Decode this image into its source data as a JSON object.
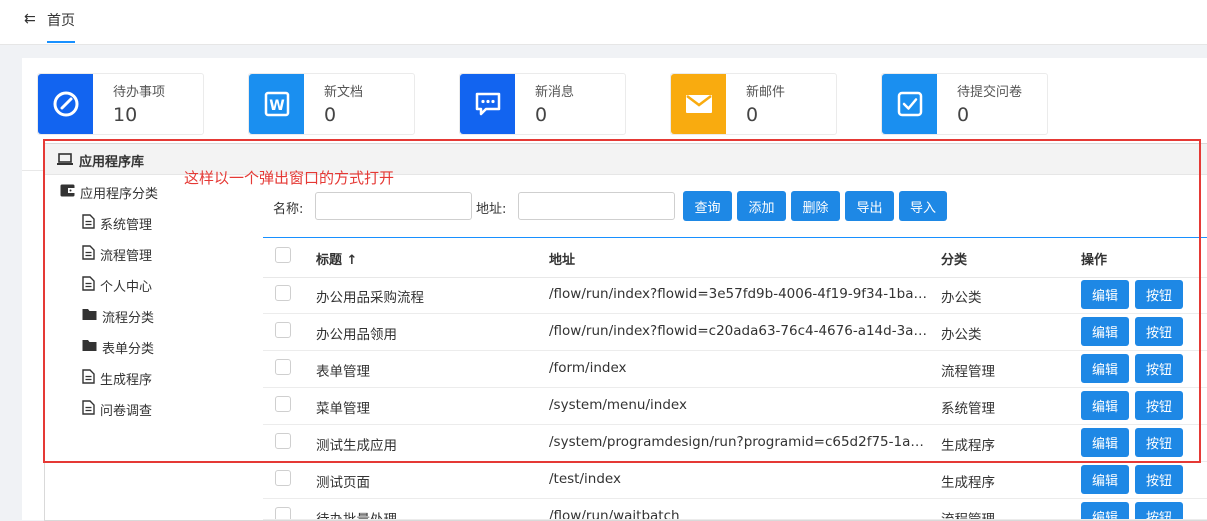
{
  "topbar": {
    "back_icon": "back-arrow-icon",
    "tab_label": "首页",
    "accent": "#1890ff"
  },
  "cards": [
    {
      "title": "待办事项",
      "value": "10",
      "icon": "edit-icon",
      "color": "#1677ff"
    },
    {
      "title": "新文档",
      "value": "0",
      "icon": "word-icon",
      "color": "#1890ff"
    },
    {
      "title": "新消息",
      "value": "0",
      "icon": "message-icon",
      "color": "#1677ff"
    },
    {
      "title": "新邮件",
      "value": "0",
      "icon": "mail-icon",
      "color": "#faad14"
    },
    {
      "title": "待提交问卷",
      "value": "0",
      "icon": "checkbox-icon",
      "color": "#1890ff"
    }
  ],
  "popup": {
    "title": "应用程序库",
    "tree": {
      "root": "应用程序分类",
      "items": [
        {
          "label": "系统管理",
          "icon": "file-icon"
        },
        {
          "label": "流程管理",
          "icon": "file-icon"
        },
        {
          "label": "个人中心",
          "icon": "file-icon"
        },
        {
          "label": "流程分类",
          "icon": "folder-icon"
        },
        {
          "label": "表单分类",
          "icon": "folder-icon"
        },
        {
          "label": "生成程序",
          "icon": "file-icon"
        },
        {
          "label": "问卷调查",
          "icon": "file-icon"
        }
      ]
    },
    "search": {
      "name_label": "名称:",
      "name_value": "",
      "address_label": "地址:",
      "address_value": ""
    },
    "buttons": [
      "查询",
      "添加",
      "删除",
      "导出",
      "导入"
    ],
    "table": {
      "columns": [
        "标题 ↑",
        "地址",
        "分类",
        "操作"
      ],
      "rows": [
        {
          "title": "办公用品采购流程",
          "address": "/flow/run/index?flowid=3e57fd9b-4006-4f19-9f34-1ba…",
          "category": "办公类"
        },
        {
          "title": "办公用品领用",
          "address": "/flow/run/index?flowid=c20ada63-76c4-4676-a14d-3a…",
          "category": "办公类"
        },
        {
          "title": "表单管理",
          "address": "/form/index",
          "category": "流程管理"
        },
        {
          "title": "菜单管理",
          "address": "/system/menu/index",
          "category": "系统管理"
        },
        {
          "title": "测试生成应用",
          "address": "/system/programdesign/run?programid=c65d2f75-1a…",
          "category": "生成程序"
        },
        {
          "title": "测试页面",
          "address": "/test/index",
          "category": "生成程序"
        },
        {
          "title": "待办批量处理",
          "address": "/flow/run/waitbatch",
          "category": "流程管理"
        }
      ],
      "edit_label": "编辑",
      "button_label": "按钮"
    }
  },
  "annotation": {
    "text": "这样以一个弹出窗口的方式打开",
    "color": "#e53935"
  }
}
